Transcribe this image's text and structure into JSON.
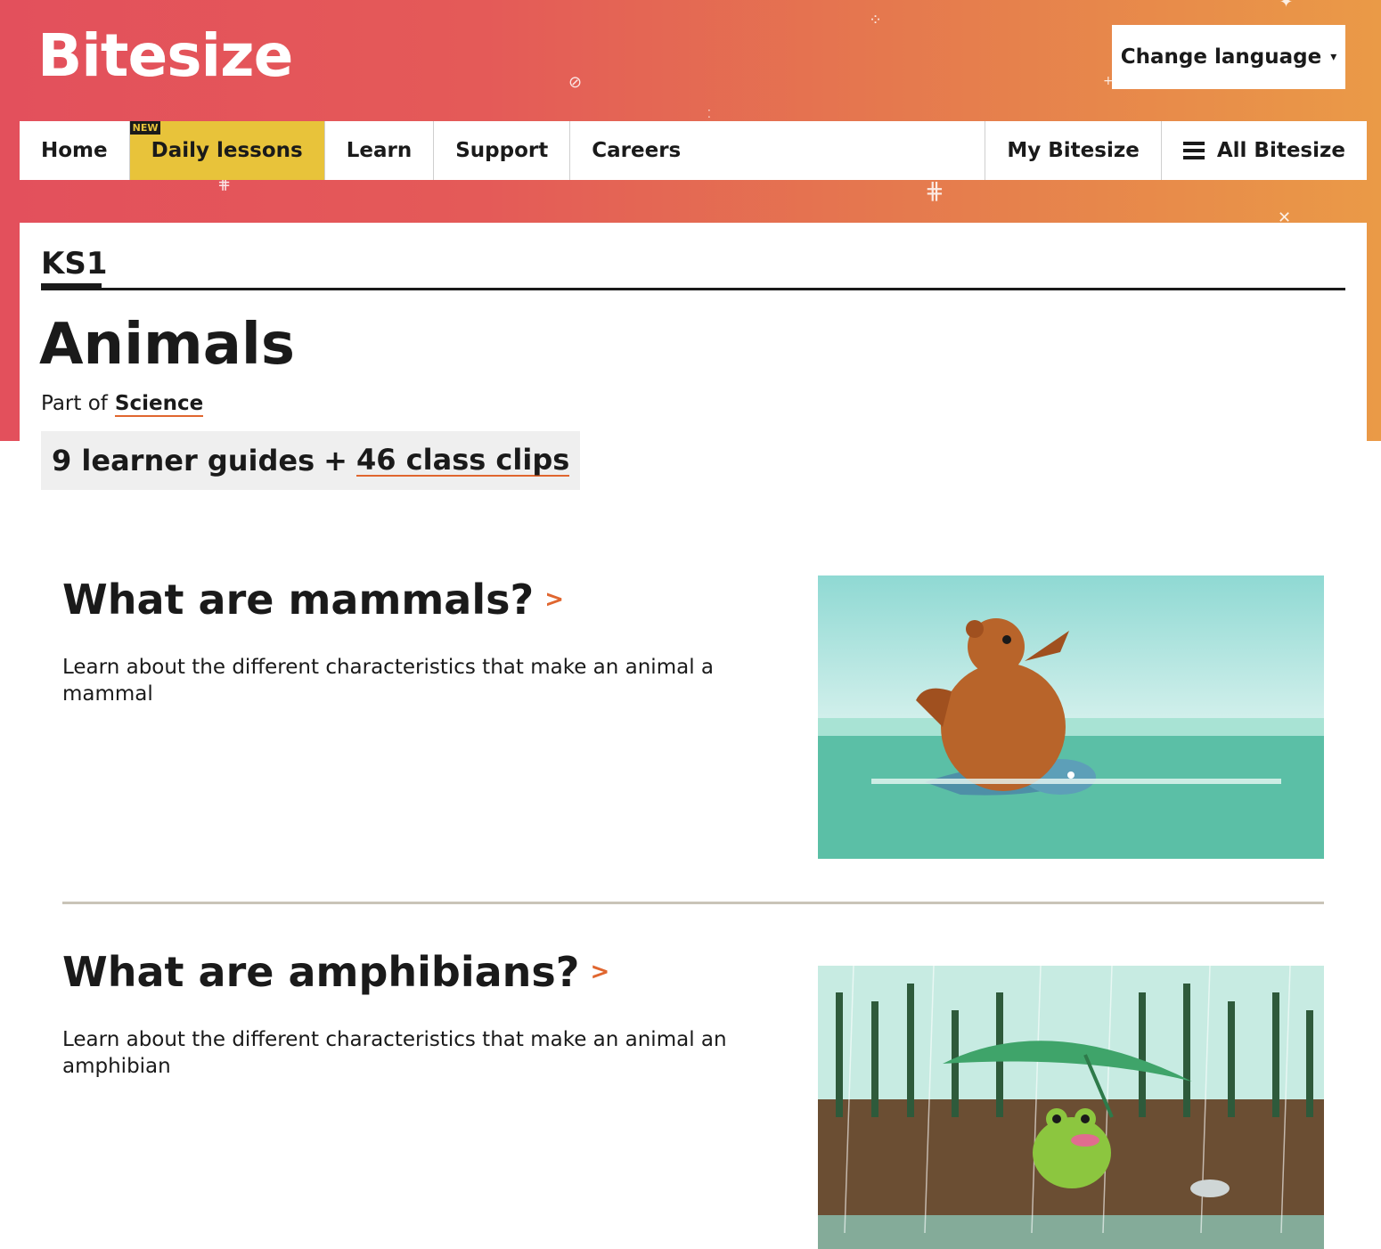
{
  "header": {
    "logo": "Bitesize",
    "change_language": "Change language",
    "caret": "▾"
  },
  "nav": {
    "items": [
      {
        "label": "Home"
      },
      {
        "label": "Daily lessons",
        "badge": "NEW"
      },
      {
        "label": "Learn"
      },
      {
        "label": "Support"
      },
      {
        "label": "Careers"
      }
    ],
    "my_bitesize": "My Bitesize",
    "all_bitesize": "All Bitesize"
  },
  "breadcrumb": {
    "level": "KS1"
  },
  "topic": {
    "title": "Animals",
    "part_of_prefix": "Part of",
    "part_of_link": "Science",
    "guides_count": "9 learner guides",
    "plus": "+",
    "clips_link": "46 class clips"
  },
  "guides": [
    {
      "title": "What are mammals?",
      "chevron": ">",
      "description": "Learn about the different characteristics that make an animal a mammal",
      "image": "bear-riding-dolphin-illustration"
    },
    {
      "title": "What are amphibians?",
      "chevron": ">",
      "description": "Learn about the different characteristics that make an animal an amphibian",
      "image": "frog-under-leaf-in-rain-illustration"
    }
  ],
  "colors": {
    "gradient_start": "#e3505c",
    "gradient_end": "#ea9a47",
    "daily_lessons_bg": "#e8c33a",
    "link_underline": "#e0662f",
    "text": "#1a1a1a"
  }
}
